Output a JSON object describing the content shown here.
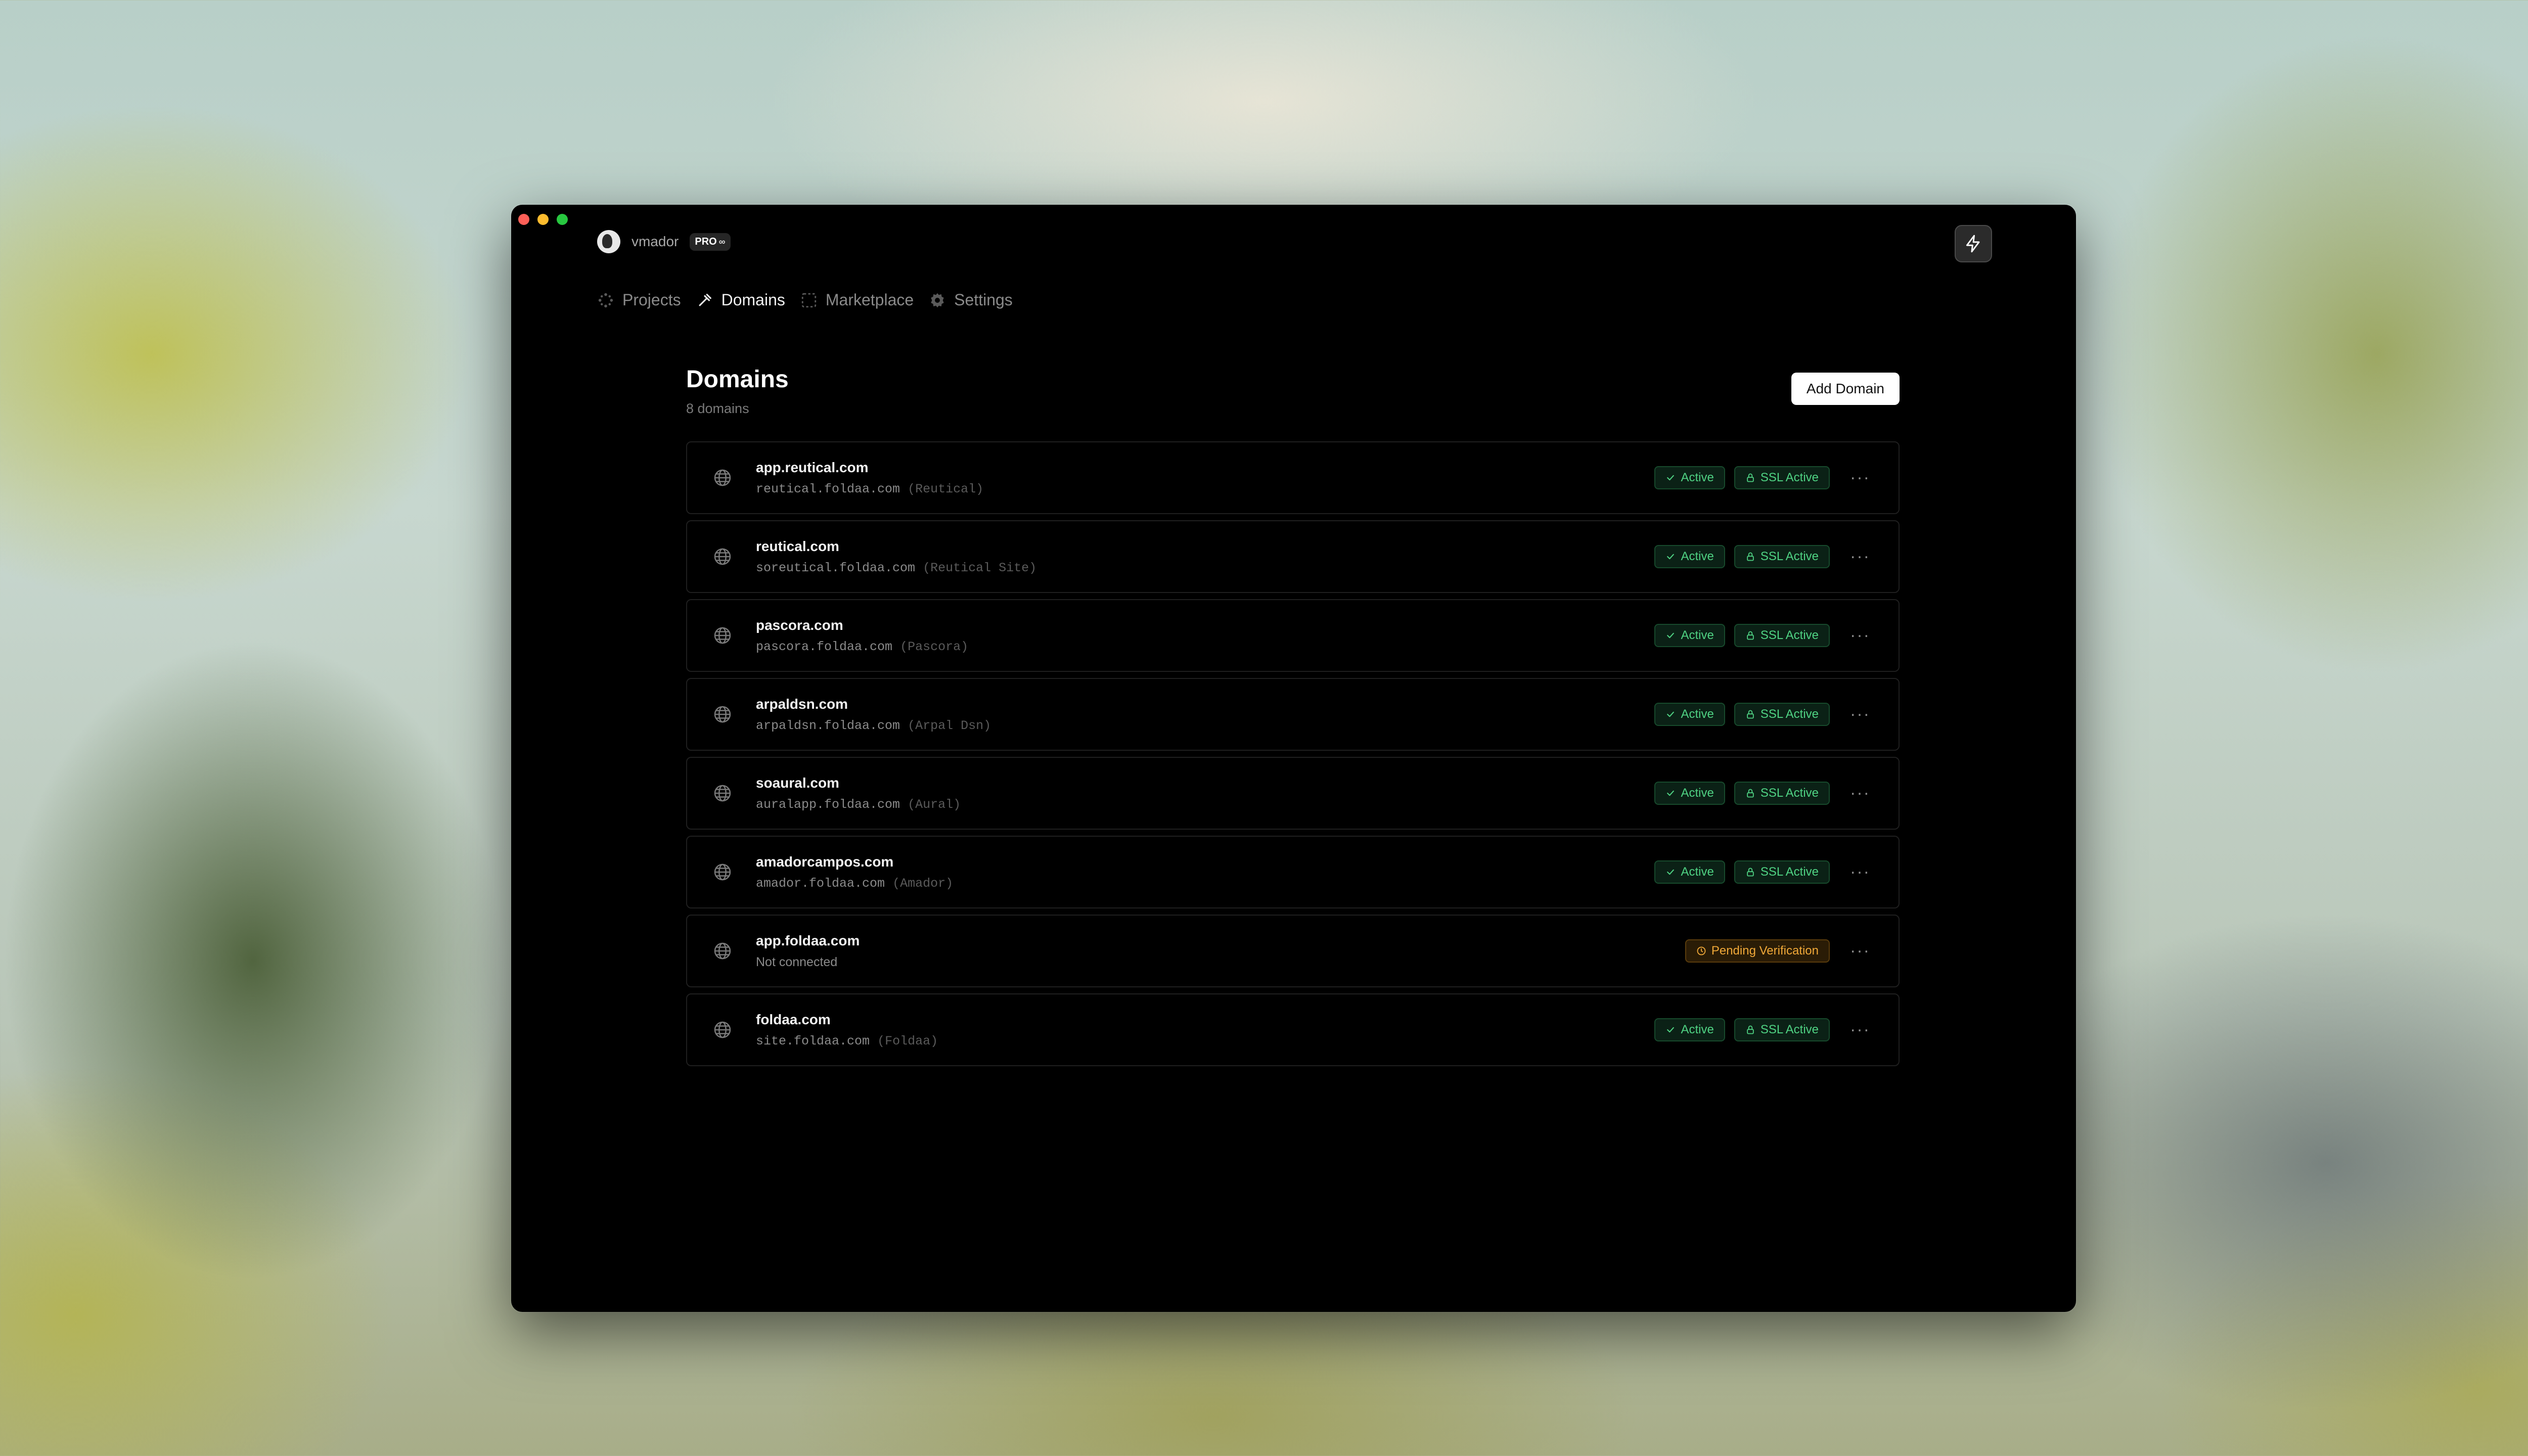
{
  "account": {
    "username": "vmador",
    "plan": "PRO",
    "plan_suffix": "∞"
  },
  "nav": [
    {
      "label": "Projects",
      "icon": "projects-icon",
      "active": false
    },
    {
      "label": "Domains",
      "icon": "domains-icon",
      "active": true
    },
    {
      "label": "Marketplace",
      "icon": "marketplace-icon",
      "active": false
    },
    {
      "label": "Settings",
      "icon": "gear-icon",
      "active": false
    }
  ],
  "page": {
    "title": "Domains",
    "subtitle": "8 domains",
    "add_button": "Add Domain"
  },
  "domains": [
    {
      "name": "app.reutical.com",
      "target": "reutical.foldaa.com",
      "project": "(Reutical)",
      "status": "Active",
      "ssl": "SSL Active"
    },
    {
      "name": "reutical.com",
      "target": "soreutical.foldaa.com",
      "project": "(Reutical Site)",
      "status": "Active",
      "ssl": "SSL Active"
    },
    {
      "name": "pascora.com",
      "target": "pascora.foldaa.com",
      "project": "(Pascora)",
      "status": "Active",
      "ssl": "SSL Active"
    },
    {
      "name": "arpaldsn.com",
      "target": "arpaldsn.foldaa.com",
      "project": "(Arpal Dsn)",
      "status": "Active",
      "ssl": "SSL Active"
    },
    {
      "name": "soaural.com",
      "target": "auralapp.foldaa.com",
      "project": "(Aural)",
      "status": "Active",
      "ssl": "SSL Active"
    },
    {
      "name": "amadorcampos.com",
      "target": "amador.foldaa.com",
      "project": "(Amador)",
      "status": "Active",
      "ssl": "SSL Active"
    },
    {
      "name": "app.foldaa.com",
      "target": "Not connected",
      "project": "",
      "status": "Pending Verification",
      "ssl": ""
    },
    {
      "name": "foldaa.com",
      "target": "site.foldaa.com",
      "project": "(Foldaa)",
      "status": "Active",
      "ssl": "SSL Active"
    }
  ],
  "more_label": "···",
  "colors": {
    "active_green": "#4fd283",
    "pending_amber": "#f0a838",
    "window_bg": "#000000"
  }
}
